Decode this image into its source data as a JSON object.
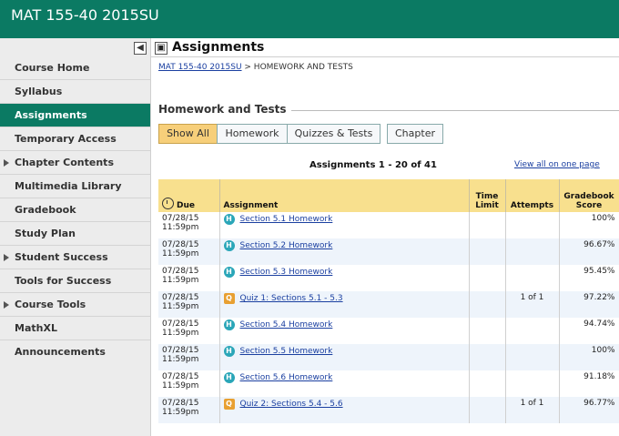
{
  "header": {
    "course_title": "MAT 155-40 2015SU"
  },
  "sidebar": {
    "items": [
      {
        "label": "Course Home",
        "expandable": false,
        "active": false
      },
      {
        "label": "Syllabus",
        "expandable": false,
        "active": false
      },
      {
        "label": "Assignments",
        "expandable": false,
        "active": true
      },
      {
        "label": "Temporary Access",
        "expandable": false,
        "active": false
      },
      {
        "label": "Chapter Contents",
        "expandable": true,
        "active": false
      },
      {
        "label": "Multimedia Library",
        "expandable": false,
        "active": false
      },
      {
        "label": "Gradebook",
        "expandable": false,
        "active": false
      },
      {
        "label": "Study Plan",
        "expandable": false,
        "active": false
      },
      {
        "label": "Student Success",
        "expandable": true,
        "active": false
      },
      {
        "label": "Tools for Success",
        "expandable": false,
        "active": false
      },
      {
        "label": "Course Tools",
        "expandable": true,
        "active": false
      },
      {
        "label": "MathXL Announcements",
        "expandable": false,
        "active": false
      }
    ]
  },
  "main": {
    "title": "Assignments",
    "breadcrumb": {
      "course_link": "MAT 155-40 2015SU",
      "separator": " > ",
      "current": "HOMEWORK AND TESTS"
    },
    "section_title": "Homework and Tests",
    "filters": {
      "show_all": "Show All",
      "homework": "Homework",
      "quizzes_tests": "Quizzes & Tests",
      "chapter": "Chapter"
    },
    "pager": "Assignments 1 - 20 of 41",
    "view_all": "View all on one page",
    "table": {
      "headers": {
        "due": "Due",
        "assignment": "Assignment",
        "time_limit": "Time Limit",
        "attempts": "Attempts",
        "score": "Gradebook Score"
      },
      "rows": [
        {
          "date": "07/28/15",
          "time": "11:59pm",
          "type": "H",
          "name": "Section 5.1 Homework",
          "time_limit": "",
          "attempts": "",
          "score": "100%"
        },
        {
          "date": "07/28/15",
          "time": "11:59pm",
          "type": "H",
          "name": "Section 5.2 Homework",
          "time_limit": "",
          "attempts": "",
          "score": "96.67%"
        },
        {
          "date": "07/28/15",
          "time": "11:59pm",
          "type": "H",
          "name": "Section 5.3 Homework",
          "time_limit": "",
          "attempts": "",
          "score": "95.45%"
        },
        {
          "date": "07/28/15",
          "time": "11:59pm",
          "type": "Q",
          "name": "Quiz 1: Sections 5.1 - 5.3",
          "time_limit": "",
          "attempts": "1 of 1",
          "score": "97.22%"
        },
        {
          "date": "07/28/15",
          "time": "11:59pm",
          "type": "H",
          "name": "Section 5.4 Homework",
          "time_limit": "",
          "attempts": "",
          "score": "94.74%"
        },
        {
          "date": "07/28/15",
          "time": "11:59pm",
          "type": "H",
          "name": "Section 5.5 Homework",
          "time_limit": "",
          "attempts": "",
          "score": "100%"
        },
        {
          "date": "07/28/15",
          "time": "11:59pm",
          "type": "H",
          "name": "Section 5.6 Homework",
          "time_limit": "",
          "attempts": "",
          "score": "91.18%"
        },
        {
          "date": "07/28/15",
          "time": "11:59pm",
          "type": "Q",
          "name": "Quiz 2: Sections 5.4 - 5.6",
          "time_limit": "",
          "attempts": "1 of 1",
          "score": "96.77%"
        }
      ]
    }
  },
  "colors": {
    "brand_green": "#0b7a63",
    "header_yellow": "#f8e08e",
    "selected_filter": "#f7cf7a",
    "link_blue": "#1a3fa0",
    "homework_badge": "#2aa6b8",
    "quiz_badge": "#e8a032"
  }
}
